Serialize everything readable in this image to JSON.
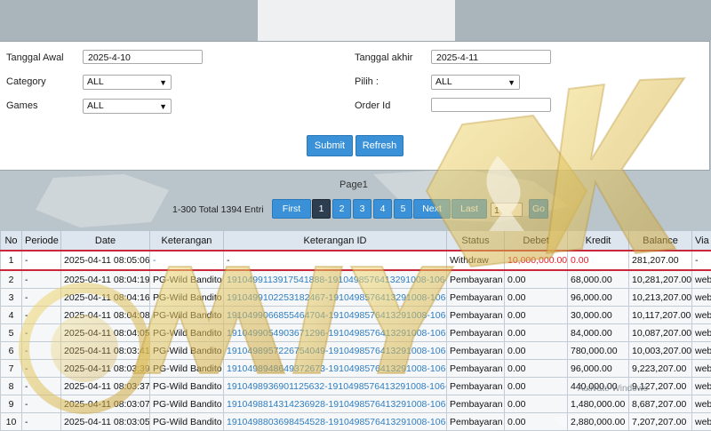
{
  "filter": {
    "tanggal_awal_label": "Tanggal Awal",
    "tanggal_awal_value": "2025-4-10",
    "tanggal_akhir_label": "Tanggal akhir",
    "tanggal_akhir_value": "2025-4-11",
    "category_label": "Category",
    "category_value": "ALL",
    "pilih_label": "Pilih  :",
    "pilih_value": "ALL",
    "games_label": "Games",
    "games_value": "ALL",
    "order_id_label": "Order Id",
    "order_id_value": "",
    "submit_label": "Submit",
    "refresh_label": "Refresh"
  },
  "pager": {
    "page_title": "Page1",
    "total_text": "1-300 Total 1394 Entri",
    "first_label": "First",
    "pages": [
      "1",
      "2",
      "3",
      "4",
      "5"
    ],
    "next_label": "Next",
    "last_label": "Last",
    "page_input": "1",
    "go_label": "Go"
  },
  "table": {
    "headers": [
      "No",
      "Periode",
      "Date",
      "Keterangan",
      "Keterangan ID",
      "Status",
      "Debet",
      "Kredit",
      "Balance",
      "Via"
    ],
    "rows": [
      [
        "1",
        "-",
        "2025-04-11 08:05:06",
        "-",
        "-",
        "Withdraw",
        "10,000,000.00",
        "0.00",
        "281,207.00",
        "-"
      ],
      [
        "2",
        "-",
        "2025-04-11 08:04:19",
        "PG-Wild Bandito",
        "1910499113917541888-1910498576413291008-106-0",
        "Pembayaran",
        "0.00",
        "68,000.00",
        "10,281,207.00",
        "web"
      ],
      [
        "3",
        "-",
        "2025-04-11 08:04:16",
        "PG-Wild Bandito",
        "1910499102253182467-1910498576413291008-106-0",
        "Pembayaran",
        "0.00",
        "96,000.00",
        "10,213,207.00",
        "web"
      ],
      [
        "4",
        "-",
        "2025-04-11 08:04:08",
        "PG-Wild Bandito",
        "1910499066855464704-1910498576413291008-106-0",
        "Pembayaran",
        "0.00",
        "30,000.00",
        "10,117,207.00",
        "web"
      ],
      [
        "5",
        "-",
        "2025-04-11 08:04:05",
        "PG-Wild Bandito",
        "1910499054903671296-1910498576413291008-106-0",
        "Pembayaran",
        "0.00",
        "84,000.00",
        "10,087,207.00",
        "web"
      ],
      [
        "6",
        "-",
        "2025-04-11 08:03:41",
        "PG-Wild Bandito",
        "1910498957226754049-1910498576413291008-106-0",
        "Pembayaran",
        "0.00",
        "780,000.00",
        "10,003,207.00",
        "web"
      ],
      [
        "7",
        "-",
        "2025-04-11 08:03:39",
        "PG-Wild Bandito",
        "1910498948649372673-1910498576413291008-106-0",
        "Pembayaran",
        "0.00",
        "96,000.00",
        "9,223,207.00",
        "web"
      ],
      [
        "8",
        "-",
        "2025-04-11 08:03:37",
        "PG-Wild Bandito",
        "1910498936901125632-1910498576413291008-106-0",
        "Pembayaran",
        "0.00",
        "440,000.00",
        "9,127,207.00",
        "web"
      ],
      [
        "9",
        "-",
        "2025-04-11 08:03:07",
        "PG-Wild Bandito",
        "1910498814314236928-1910498576413291008-106-0",
        "Pembayaran",
        "0.00",
        "1,480,000.00",
        "8,687,207.00",
        "web"
      ],
      [
        "10",
        "-",
        "2025-04-11 08:03:05",
        "PG-Wild Bandito",
        "1910498803698454528-1910498576413291008-106-0",
        "Pembayaran",
        "0.00",
        "2,880,000.00",
        "7,207,207.00",
        "web"
      ]
    ]
  },
  "overlay": {
    "watermark_logo": "MIYAUK",
    "activate_text": "Activate Windows"
  },
  "colors": {
    "accent": "#3a91d8",
    "active_page": "#2c3e50",
    "highlight": "#c9283a",
    "link": "#2f7ec2",
    "red_text": "#e41e2b",
    "header_bg": "#dde6ef"
  }
}
